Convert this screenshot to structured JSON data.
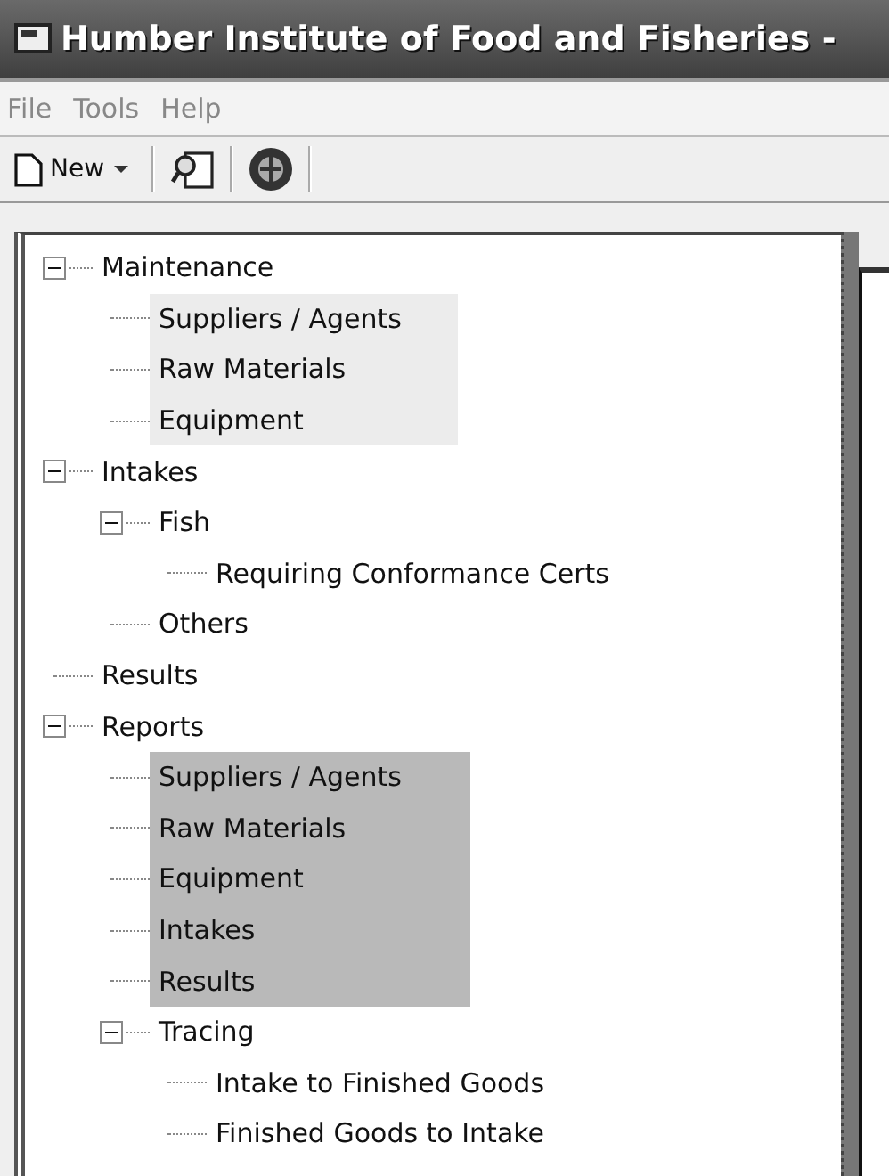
{
  "window": {
    "title": "Humber Institute of Food and Fisheries -"
  },
  "menu": [
    "File",
    "Tools",
    "Help"
  ],
  "toolbar": {
    "new_button": "New"
  },
  "tree": [
    {
      "label": "Maintenance",
      "selected": false,
      "shaded": false,
      "expanded": true,
      "children": [
        {
          "label": "Suppliers / Agents",
          "selected": false,
          "shaded": true
        },
        {
          "label": "Raw Materials",
          "selected": false,
          "shaded": true
        },
        {
          "label": "Equipment",
          "selected": false,
          "shaded": true
        }
      ]
    },
    {
      "label": "Intakes",
      "selected": false,
      "shaded": false,
      "expanded": true,
      "children": [
        {
          "label": "Fish",
          "selected": false,
          "shaded": false,
          "expanded": true,
          "children": [
            {
              "label": "Requiring Conformance Certs",
              "selected": false,
              "shaded": false
            }
          ]
        },
        {
          "label": "Others",
          "selected": false,
          "shaded": false
        }
      ]
    },
    {
      "label": "Results",
      "selected": false,
      "shaded": false
    },
    {
      "label": "Reports",
      "selected": false,
      "shaded": false,
      "expanded": true,
      "children": [
        {
          "label": "Suppliers / Agents",
          "selected": true,
          "shaded": false
        },
        {
          "label": "Raw Materials",
          "selected": true,
          "shaded": false
        },
        {
          "label": "Equipment",
          "selected": true,
          "shaded": false
        },
        {
          "label": "Intakes",
          "selected": true,
          "shaded": false
        },
        {
          "label": "Results",
          "selected": true,
          "shaded": false
        },
        {
          "label": "Tracing",
          "selected": false,
          "shaded": false,
          "expanded": true,
          "children": [
            {
              "label": "Intake to Finished Goods",
              "selected": false,
              "shaded": false
            },
            {
              "label": "Finished Goods to Intake",
              "selected": false,
              "shaded": false
            }
          ]
        }
      ]
    }
  ]
}
